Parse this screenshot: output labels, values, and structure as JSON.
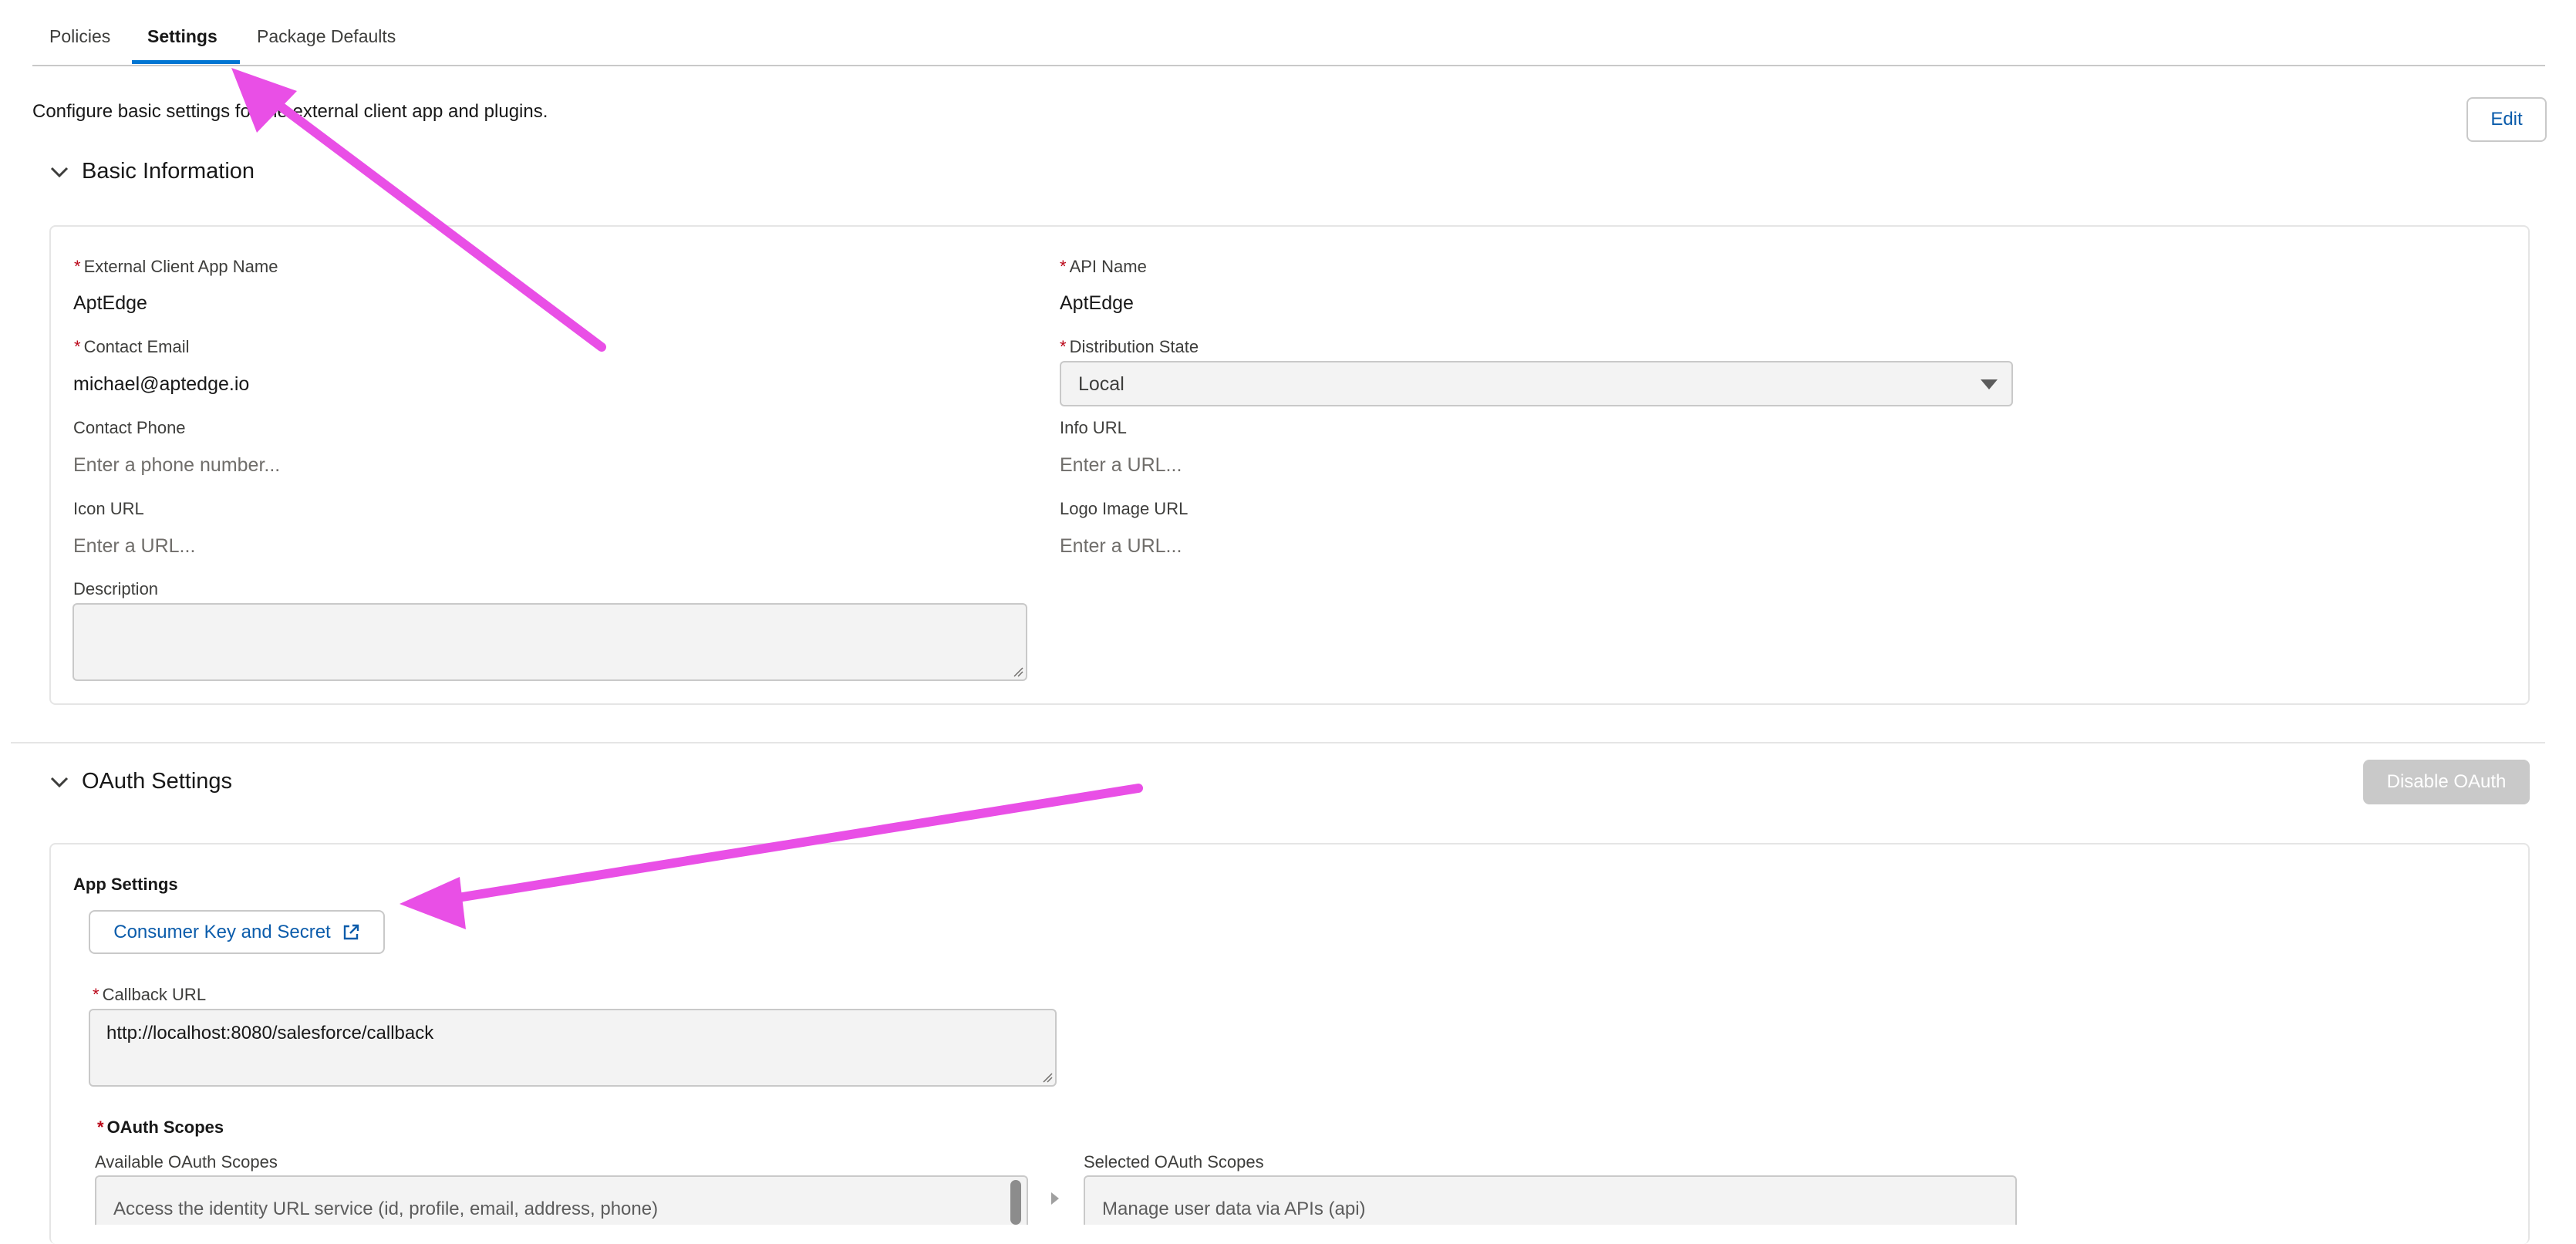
{
  "tabs": [
    {
      "label": "Policies"
    },
    {
      "label": "Settings"
    },
    {
      "label": "Package Defaults"
    }
  ],
  "intro_text": "Configure basic settings for the external client app and plugins.",
  "edit_button": "Edit",
  "basic_info": {
    "title": "Basic Information",
    "app_name_label": "External Client App Name",
    "app_name_value": "AptEdge",
    "api_name_label": "API Name",
    "api_name_value": "AptEdge",
    "contact_email_label": "Contact Email",
    "contact_email_value": "michael@aptedge.io",
    "distribution_state_label": "Distribution State",
    "distribution_state_value": "Local",
    "contact_phone_label": "Contact Phone",
    "contact_phone_placeholder": "Enter a phone number...",
    "info_url_label": "Info URL",
    "info_url_placeholder": "Enter a URL...",
    "icon_url_label": "Icon URL",
    "icon_url_placeholder": "Enter a URL...",
    "logo_url_label": "Logo Image URL",
    "logo_url_placeholder": "Enter a URL...",
    "description_label": "Description",
    "description_value": ""
  },
  "oauth": {
    "title": "OAuth Settings",
    "disable_button": "Disable OAuth",
    "app_settings_label": "App Settings",
    "consumer_key_button": "Consumer Key and Secret",
    "callback_label": "Callback URL",
    "callback_value": "http://localhost:8080/salesforce/callback",
    "scopes_label": "OAuth Scopes",
    "available_label": "Available OAuth Scopes",
    "available_items": [
      "Access the identity URL service (id, profile, email, address, phone)"
    ],
    "selected_label": "Selected OAuth Scopes",
    "selected_items": [
      "Manage user data via APIs (api)"
    ]
  },
  "colors": {
    "accent": "#0176d3",
    "link": "#0b5cab",
    "required": "#ba0517",
    "annotation_arrow": "#e94fe6"
  },
  "icons": [
    "chevron-down-icon",
    "external-link-icon",
    "dropdown-caret-icon",
    "resize-handle-icon",
    "move-right-icon",
    "annotation-arrow"
  ]
}
